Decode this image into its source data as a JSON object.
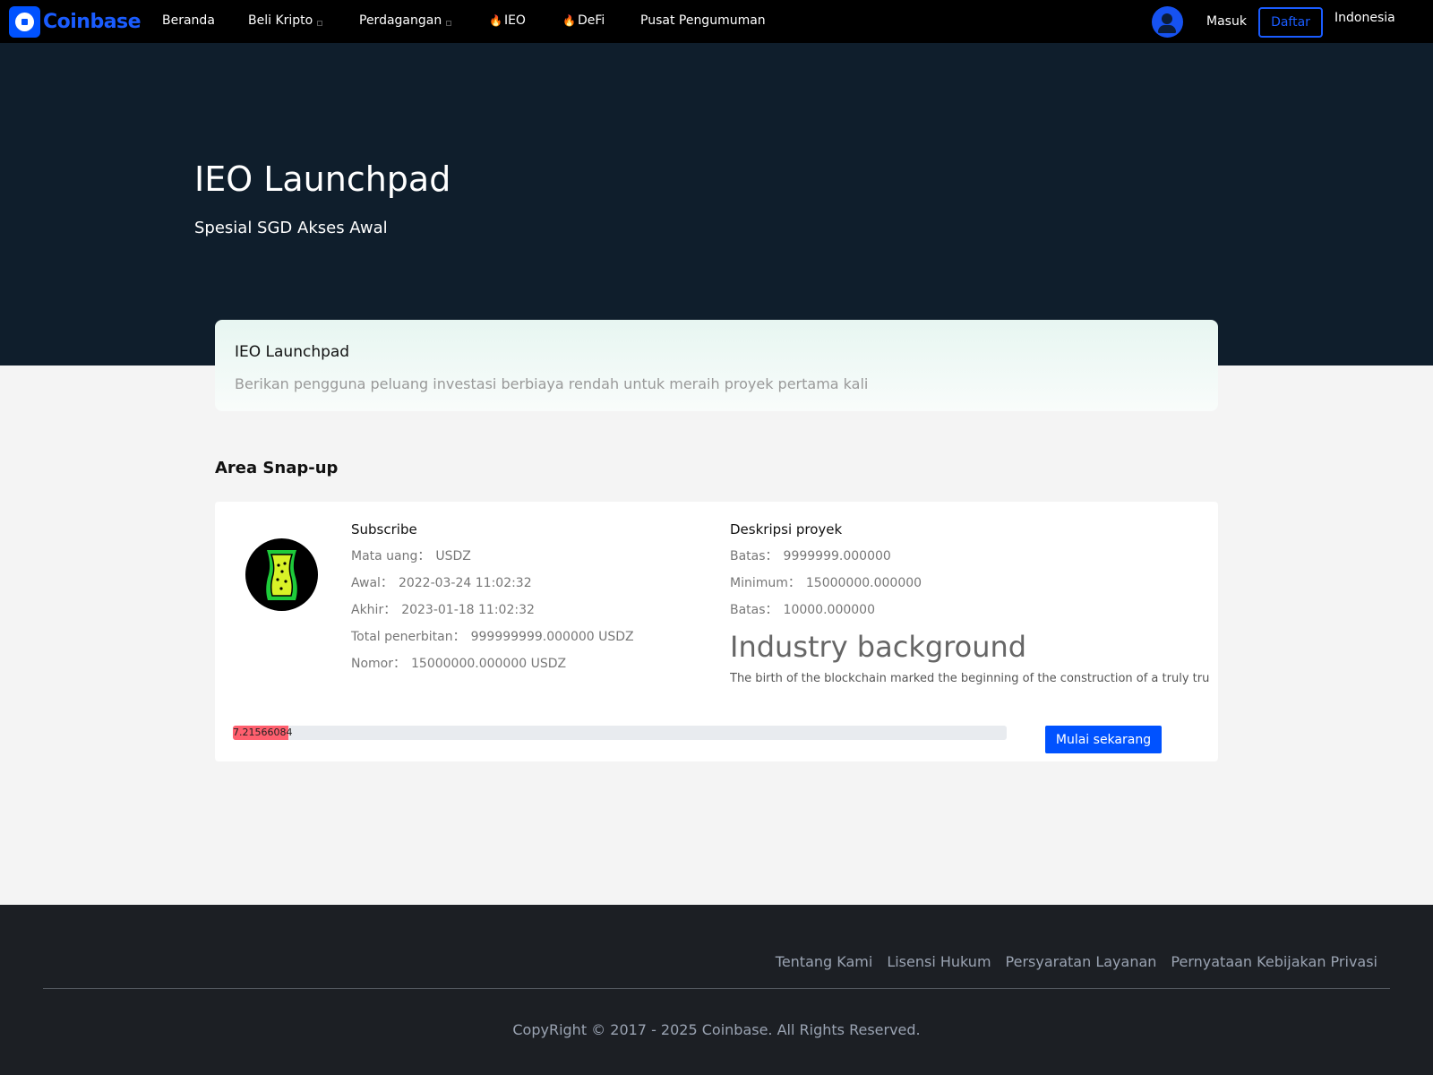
{
  "nav": {
    "brand": "Coinbase",
    "items": [
      {
        "label": "Beranda",
        "dropdown": false,
        "hot": false
      },
      {
        "label": "Beli Kripto",
        "dropdown": true,
        "hot": false
      },
      {
        "label": "Perdagangan",
        "dropdown": true,
        "hot": false
      },
      {
        "label": "IEO",
        "dropdown": false,
        "hot": true
      },
      {
        "label": "DeFi",
        "dropdown": false,
        "hot": true
      },
      {
        "label": "Pusat Pengumuman",
        "dropdown": false,
        "hot": false
      }
    ],
    "login": "Masuk",
    "register": "Daftar",
    "language": "Indonesia",
    "accent_color": "#0052ff"
  },
  "hero": {
    "title": "IEO Launchpad",
    "subtitle": "Spesial SGD Akses Awal"
  },
  "intro": {
    "title": "IEO Launchpad",
    "description": "Berikan pengguna peluang investasi berbiaya rendah untuk meraih proyek pertama kali"
  },
  "section_title": "Area Snap-up",
  "project": {
    "icon": "beer-glass-icon",
    "subscribe": {
      "title": "Subscribe",
      "rows": [
        {
          "label": "Mata uang：",
          "value": "USDZ"
        },
        {
          "label": "Awal：",
          "value": "2022-03-24 11:02:32"
        },
        {
          "label": "Akhir：",
          "value": "2023-01-18 11:02:32"
        },
        {
          "label": "Total penerbitan：",
          "value": "999999999.000000 USDZ"
        },
        {
          "label": "Nomor：",
          "value": "15000000.000000 USDZ"
        }
      ]
    },
    "description": {
      "title": "Deskripsi proyek",
      "rows": [
        {
          "label": "Batas：",
          "value": "9999999.000000"
        },
        {
          "label": "Minimum：",
          "value": "15000000.000000"
        },
        {
          "label": "Batas：",
          "value": "10000.000000"
        }
      ],
      "industry_heading": "Industry background",
      "industry_text": "The birth of the blockchain marked the beginning of the construction of a truly tru"
    },
    "progress_label": "7.21566084",
    "progress_percent": 7.21566084,
    "button": "Mulai sekarang"
  },
  "footer": {
    "links": [
      "Tentang Kami",
      "Lisensi Hukum",
      "Persyaratan Layanan",
      "Pernyataan Kebijakan Privasi"
    ],
    "copyright": "CopyRight © 2017 - 2025 Coinbase. All Rights Reserved."
  }
}
